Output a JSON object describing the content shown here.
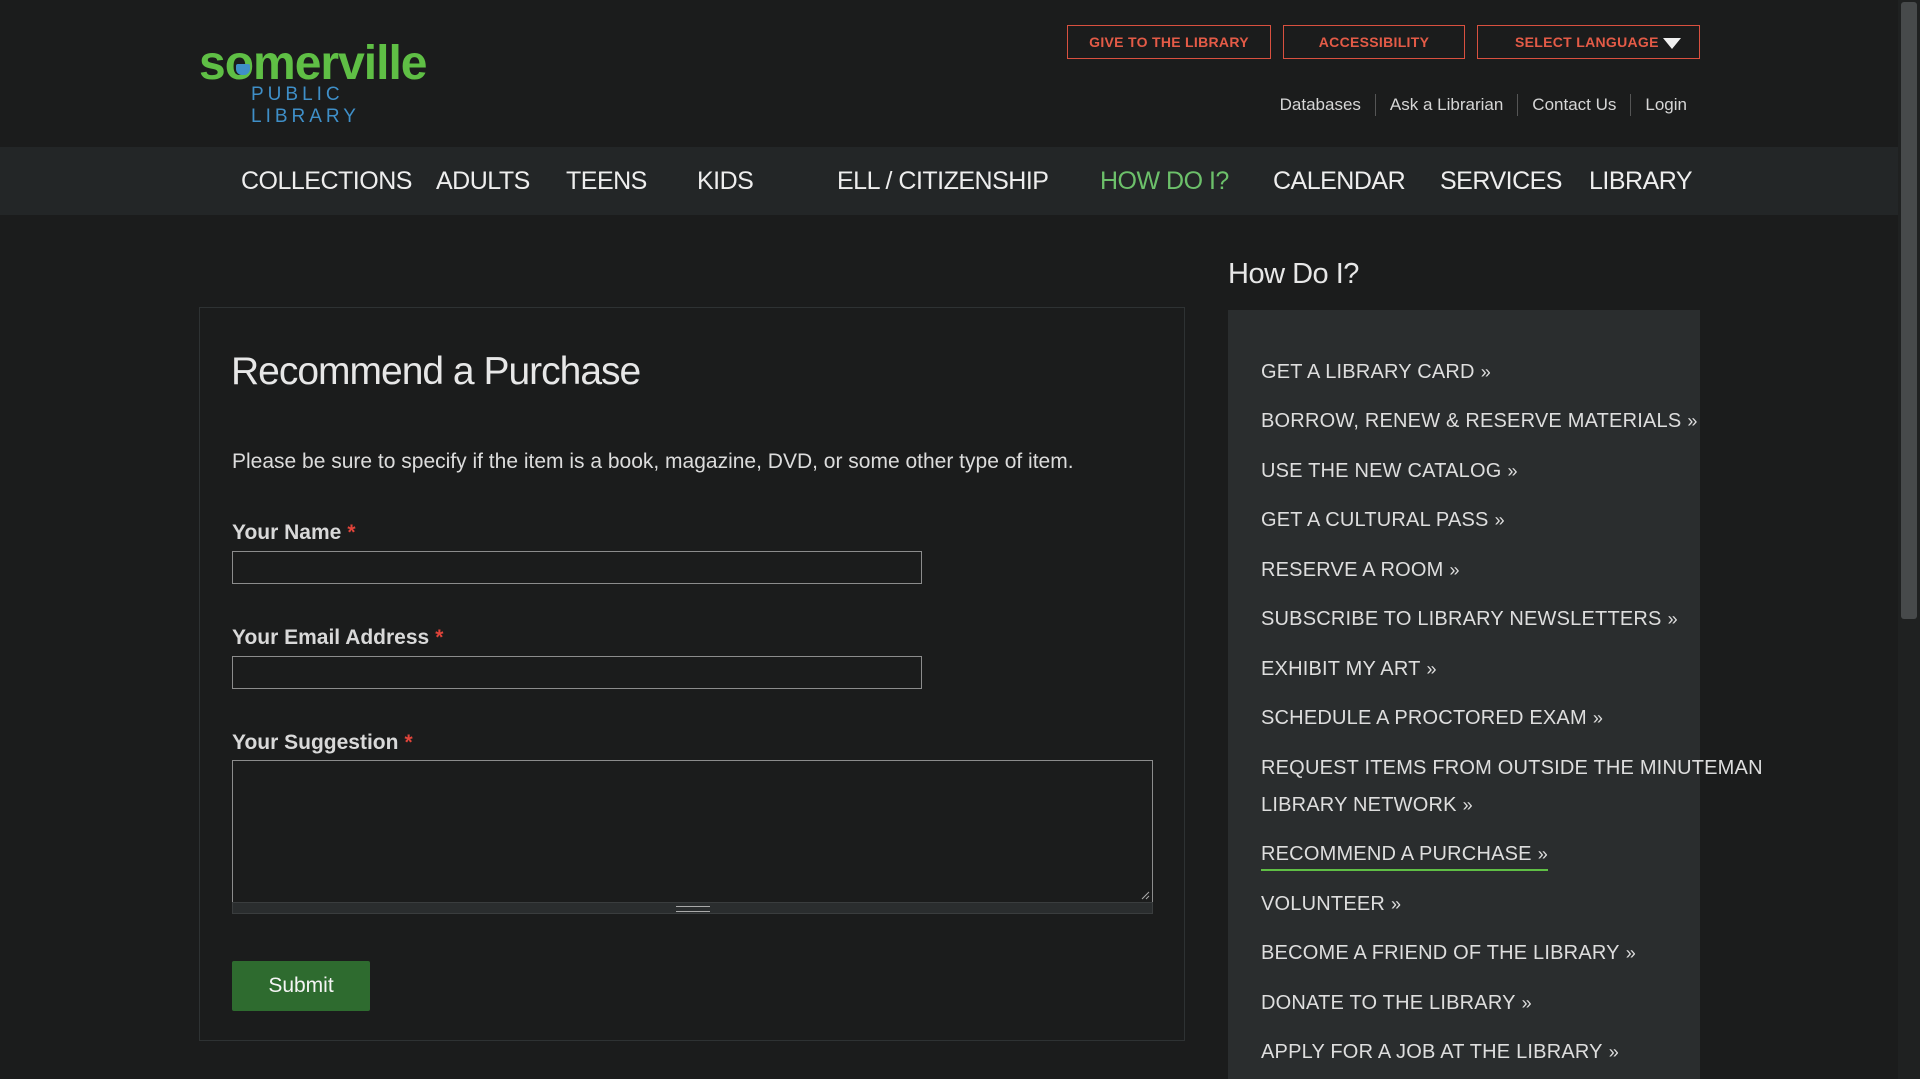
{
  "header": {
    "logo_word": "somerville",
    "logo_sub": "PUBLIC LIBRARY",
    "give_label": "GIVE TO THE LIBRARY",
    "accessibility_label": "ACCESSIBILITY",
    "language_label": "SELECT LANGUAGE",
    "utility_links": [
      "Databases",
      "Ask a Librarian",
      "Contact Us",
      "Login"
    ]
  },
  "nav": {
    "items": [
      "COLLECTIONS",
      "ADULTS",
      "TEENS",
      "KIDS",
      "ELL / CITIZENSHIP",
      "HOW DO I?",
      "CALENDAR",
      "SERVICES",
      "LIBRARY"
    ],
    "active": "HOW DO I?"
  },
  "form": {
    "title": "Recommend a Purchase",
    "intro": "Please be sure to specify if the item is a book, magazine, DVD, or some other type of item.",
    "name_label": "Your Name",
    "name_value": "",
    "email_label": "Your Email Address",
    "email_value": "",
    "suggestion_label": "Your Suggestion",
    "suggestion_value": "",
    "required_mark": "*",
    "submit_label": "Submit"
  },
  "sidebar": {
    "heading": "How Do I?",
    "links": [
      "GET A LIBRARY CARD",
      "BORROW, RENEW & RESERVE MATERIALS",
      "USE THE NEW CATALOG",
      "GET A CULTURAL PASS",
      "RESERVE A ROOM",
      "SUBSCRIBE TO LIBRARY NEWSLETTERS",
      "EXHIBIT MY ART",
      "SCHEDULE A PROCTORED EXAM",
      "REQUEST ITEMS FROM OUTSIDE THE MINUTEMAN",
      "LIBRARY NETWORK",
      "RECOMMEND A PURCHASE",
      "VOLUNTEER",
      "BECOME A FRIEND OF THE LIBRARY",
      "DONATE TO THE LIBRARY",
      "APPLY FOR A JOB AT THE LIBRARY"
    ],
    "current": "RECOMMEND A PURCHASE",
    "chevron": "»"
  },
  "colors": {
    "background": "#1b1c1c",
    "accent_green": "#5fbf45",
    "accent_red": "#e45b47",
    "logo_blue": "#3f8fc8",
    "submit_green": "#2e6b2f"
  },
  "icons": {
    "language_caret": "caret-down-icon",
    "link_chevron": "double-chevron-right-icon",
    "textarea_resize": "resize-grip-icon"
  }
}
